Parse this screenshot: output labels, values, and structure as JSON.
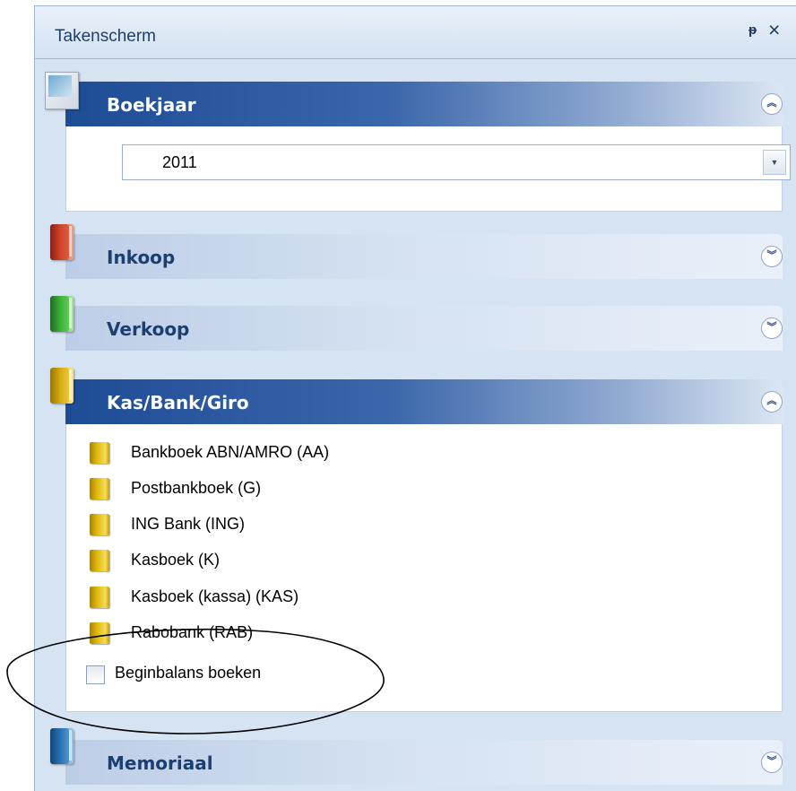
{
  "pane": {
    "title": "Takenscherm",
    "pin_glyph": "ᵽ",
    "close_glyph": "×"
  },
  "groups": [
    {
      "title": "Boekjaar",
      "state": "expanded",
      "icon": "calendar-icon",
      "combo_value": "2011",
      "combo_arrow": "▼"
    },
    {
      "title": "Inkoop",
      "state": "collapsed",
      "icon": "book-icon",
      "icon_color": "#c83a22"
    },
    {
      "title": "Verkoop",
      "state": "collapsed",
      "icon": "book-icon",
      "icon_color": "#3aa334"
    },
    {
      "title": "Kas/Bank/Giro",
      "state": "expanded",
      "icon": "book-icon",
      "icon_color": "#d6ad10",
      "items": [
        "Bankboek ABN/AMRO (AA)",
        "Postbankboek (G)",
        "ING Bank (ING)",
        "Kasboek (K)",
        "Kasboek (kassa) (KAS)",
        "Rabobank (RAB)"
      ],
      "checkbox_label": "Beginbalans boeken"
    },
    {
      "title": "Memoriaal",
      "state": "collapsed",
      "icon": "book-icon",
      "icon_color": "#2a6fb0"
    }
  ],
  "toggle_glyphs": {
    "expanded": "︽",
    "collapsed": "︾"
  }
}
